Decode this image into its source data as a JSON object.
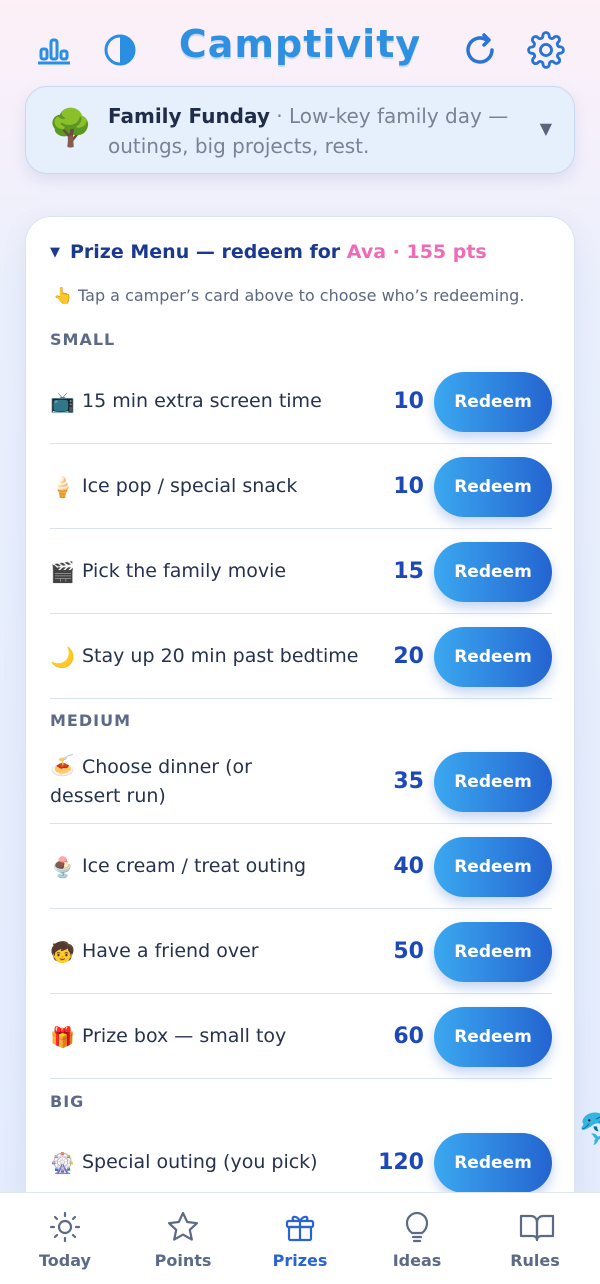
{
  "header": {
    "app_title": "Camptivity",
    "icons": [
      "stats-icon",
      "theme-icon",
      "refresh-icon",
      "settings-icon"
    ]
  },
  "day": {
    "emoji": "🌳",
    "name": "Family Funday",
    "separator": " · ",
    "description": "Low-key family day — outings, big projects, rest."
  },
  "prize_menu": {
    "title_prefix": "Prize Menu — redeem for ",
    "camper": "Ava · 155 pts",
    "hint": "👆 Tap a camper’s card above to choose who’s redeeming.",
    "sections": [
      {
        "name": "SMALL",
        "items": [
          {
            "emoji": "📺",
            "label": "15 min extra screen time",
            "points": "10",
            "button": "Redeem"
          },
          {
            "emoji": "🍦",
            "label": "Ice pop / special snack",
            "points": "10",
            "button": "Redeem"
          },
          {
            "emoji": "🎬",
            "label": "Pick the family movie",
            "points": "15",
            "button": "Redeem"
          },
          {
            "emoji": "🌙",
            "label": "Stay up 20 min past bedtime",
            "points": "20",
            "button": "Redeem"
          }
        ]
      },
      {
        "name": "MEDIUM",
        "items": [
          {
            "emoji": "🍝",
            "label": "Choose dinner (or dessert run)",
            "points": "35",
            "button": "Redeem"
          },
          {
            "emoji": "🍨",
            "label": "Ice cream / treat outing",
            "points": "40",
            "button": "Redeem"
          },
          {
            "emoji": "🧒",
            "label": "Have a friend over",
            "points": "50",
            "button": "Redeem"
          },
          {
            "emoji": "🎁",
            "label": "Prize box — small toy",
            "points": "60",
            "button": "Redeem"
          }
        ]
      },
      {
        "name": "BIG",
        "items": [
          {
            "emoji": "🎡",
            "label": "Special outing (you pick)",
            "points": "120",
            "button": "Redeem"
          }
        ]
      }
    ]
  },
  "nav": {
    "items": [
      {
        "label": "Today",
        "icon": "sun-icon"
      },
      {
        "label": "Points",
        "icon": "star-icon"
      },
      {
        "label": "Prizes",
        "icon": "gift-icon",
        "active": true
      },
      {
        "label": "Ideas",
        "icon": "lightbulb-icon"
      },
      {
        "label": "Rules",
        "icon": "book-icon"
      }
    ]
  },
  "colors": {
    "accent": "#2a63d4",
    "points": "#1d49b8",
    "camper": "#f06bb7",
    "button_start": "#3ba8f0",
    "button_end": "#2464d0"
  }
}
